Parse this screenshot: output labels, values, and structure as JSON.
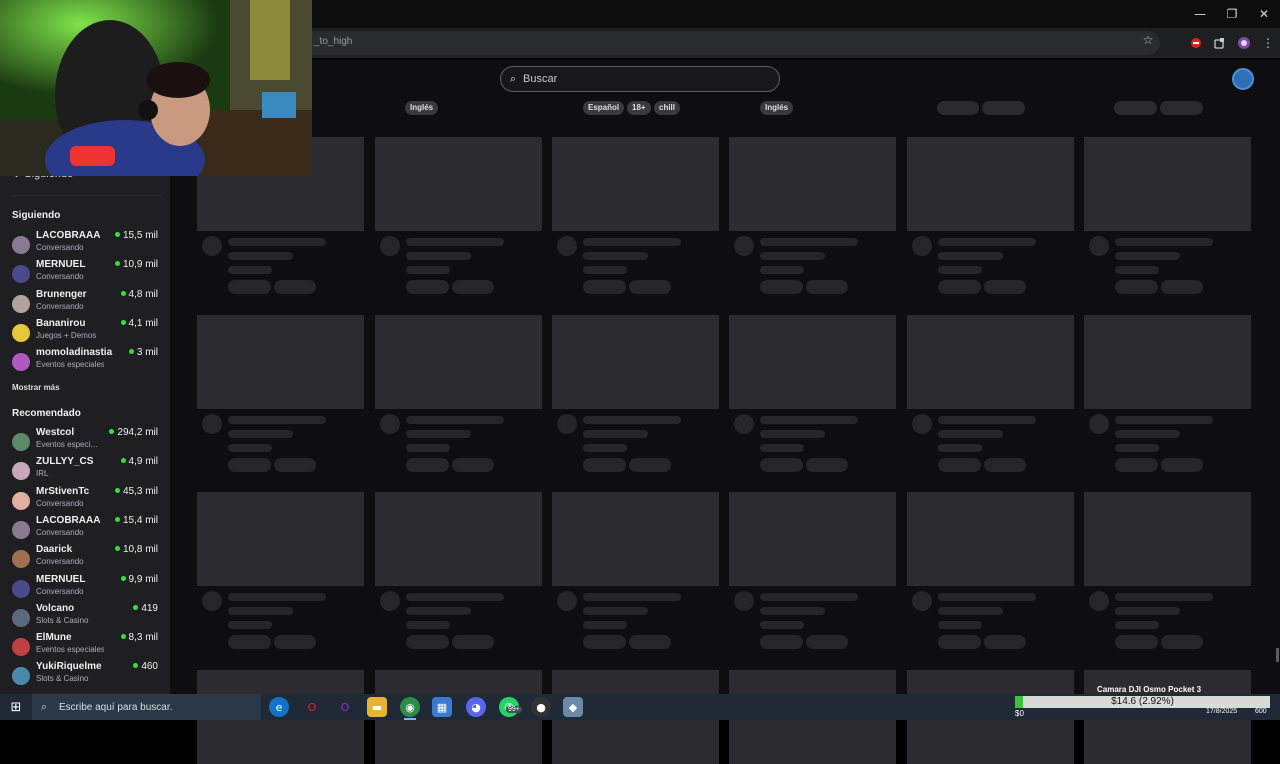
{
  "browser": {
    "url_fragment": "_to_high",
    "window_controls": [
      "—",
      "❐",
      "✕"
    ],
    "toolbar_icons": [
      "star-icon",
      "adblock-icon",
      "extensions-icon",
      "profile-icon",
      "menu-icon"
    ]
  },
  "twitch": {
    "search_placeholder": "Buscar",
    "sidebar": {
      "collapse_label": "Siguiendo",
      "following_heading": "Siguiendo",
      "following": [
        {
          "name": "LACOBRAAA",
          "category": "Conversando",
          "viewers": "15,5 mil",
          "color": "#8a7a8f"
        },
        {
          "name": "MERNUEL",
          "category": "Conversando",
          "viewers": "10,9 mil",
          "color": "#4a4a8a"
        },
        {
          "name": "Brunenger",
          "category": "Conversando",
          "viewers": "4,8 mil",
          "color": "#b0a49a"
        },
        {
          "name": "Bananirou",
          "category": "Juegos + Demos",
          "viewers": "4,1 mil",
          "color": "#e6c63a"
        },
        {
          "name": "momoladinastia",
          "category": "Eventos especiales",
          "viewers": "3 mil",
          "color": "#b05ac0"
        }
      ],
      "show_more": "Mostrar más",
      "recommended_heading": "Recomendado",
      "recommended": [
        {
          "name": "Westcol",
          "category": "Eventos especi…",
          "viewers": "294,2 mil",
          "color": "#5a8a6a"
        },
        {
          "name": "ZULLYY_CS",
          "category": "IRL",
          "viewers": "4,9 mil",
          "color": "#c8a8b8"
        },
        {
          "name": "MrStivenTc",
          "category": "Conversando",
          "viewers": "45,3 mil",
          "color": "#e0b0a0"
        },
        {
          "name": "LACOBRAAA",
          "category": "Conversando",
          "viewers": "15,4 mil",
          "color": "#8a7a8f"
        },
        {
          "name": "Daarick",
          "category": "Conversando",
          "viewers": "10,8 mil",
          "color": "#a07050"
        },
        {
          "name": "MERNUEL",
          "category": "Conversando",
          "viewers": "9,9 mil",
          "color": "#4a4a8a"
        },
        {
          "name": "Volcano",
          "category": "Slots & Casino",
          "viewers": "419",
          "color": "#5a6a7a"
        },
        {
          "name": "ElMune",
          "category": "Eventos especiales",
          "viewers": "8,3 mil",
          "color": "#c04040"
        },
        {
          "name": "YukiRiquelme",
          "category": "Slots & Casino",
          "viewers": "460",
          "color": "#4a8aa8"
        }
      ]
    },
    "tags": [
      "Inglés",
      "Español",
      "18+",
      "chill",
      "Inglés"
    ]
  },
  "taskbar": {
    "search_placeholder": "Escribe aquí para buscar.",
    "badge": "99+",
    "camera_label": "Camara DJI Osmo Pocket 3",
    "stock_text": "$14.6 (2.92%)",
    "stock_fill_fraction": 0.03,
    "stock_zero": "$0",
    "date": "17/8/2025",
    "tray_text": "600"
  }
}
